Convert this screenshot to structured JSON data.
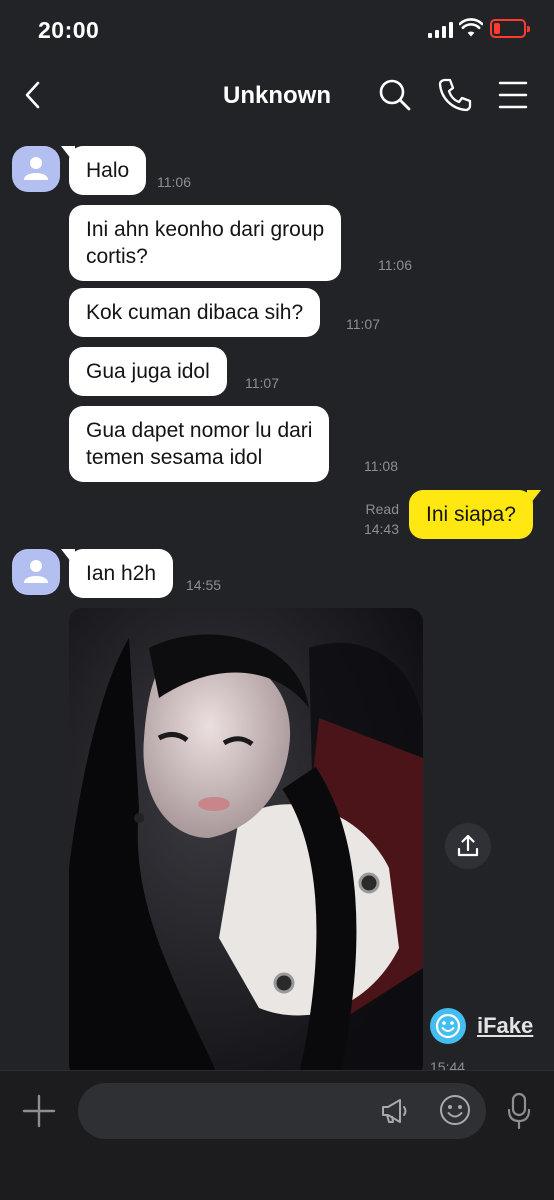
{
  "status_bar": {
    "time": "20:00"
  },
  "header": {
    "title": "Unknown"
  },
  "messages": [
    {
      "text_lines": [
        "Halo"
      ],
      "time": "11:06"
    },
    {
      "text_lines": [
        "Ini ahn keonho dari group",
        "cortis?"
      ],
      "time": "11:06"
    },
    {
      "text_lines": [
        "Kok cuman dibaca sih?"
      ],
      "time": "11:07"
    },
    {
      "text_lines": [
        "Gua juga idol"
      ],
      "time": "11:07"
    },
    {
      "text_lines": [
        "Gua dapet nomor lu dari",
        "temen sesama idol"
      ],
      "time": "11:08"
    },
    {
      "text_lines": [
        "Ini siapa?"
      ],
      "read_label": "Read",
      "time": "14:43"
    },
    {
      "text_lines": [
        "Ian h2h"
      ],
      "time": "14:55"
    },
    {
      "time": "15:44"
    }
  ],
  "watermark": {
    "text": "iFake"
  },
  "icons": {
    "back": "chevron-left-icon",
    "search": "search-icon",
    "call": "phone-icon",
    "menu": "menu-icon",
    "share": "share-icon",
    "add": "plus-icon",
    "announce": "megaphone-icon",
    "emoji": "emoji-icon",
    "voice": "microphone-icon"
  },
  "colors": {
    "background": "#222326",
    "incoming_bubble": "#ffffff",
    "outgoing_bubble": "#ffe812",
    "avatar": "#b3bff0",
    "battery_low": "#ff3b30",
    "timestamp": "#8d8e92"
  }
}
